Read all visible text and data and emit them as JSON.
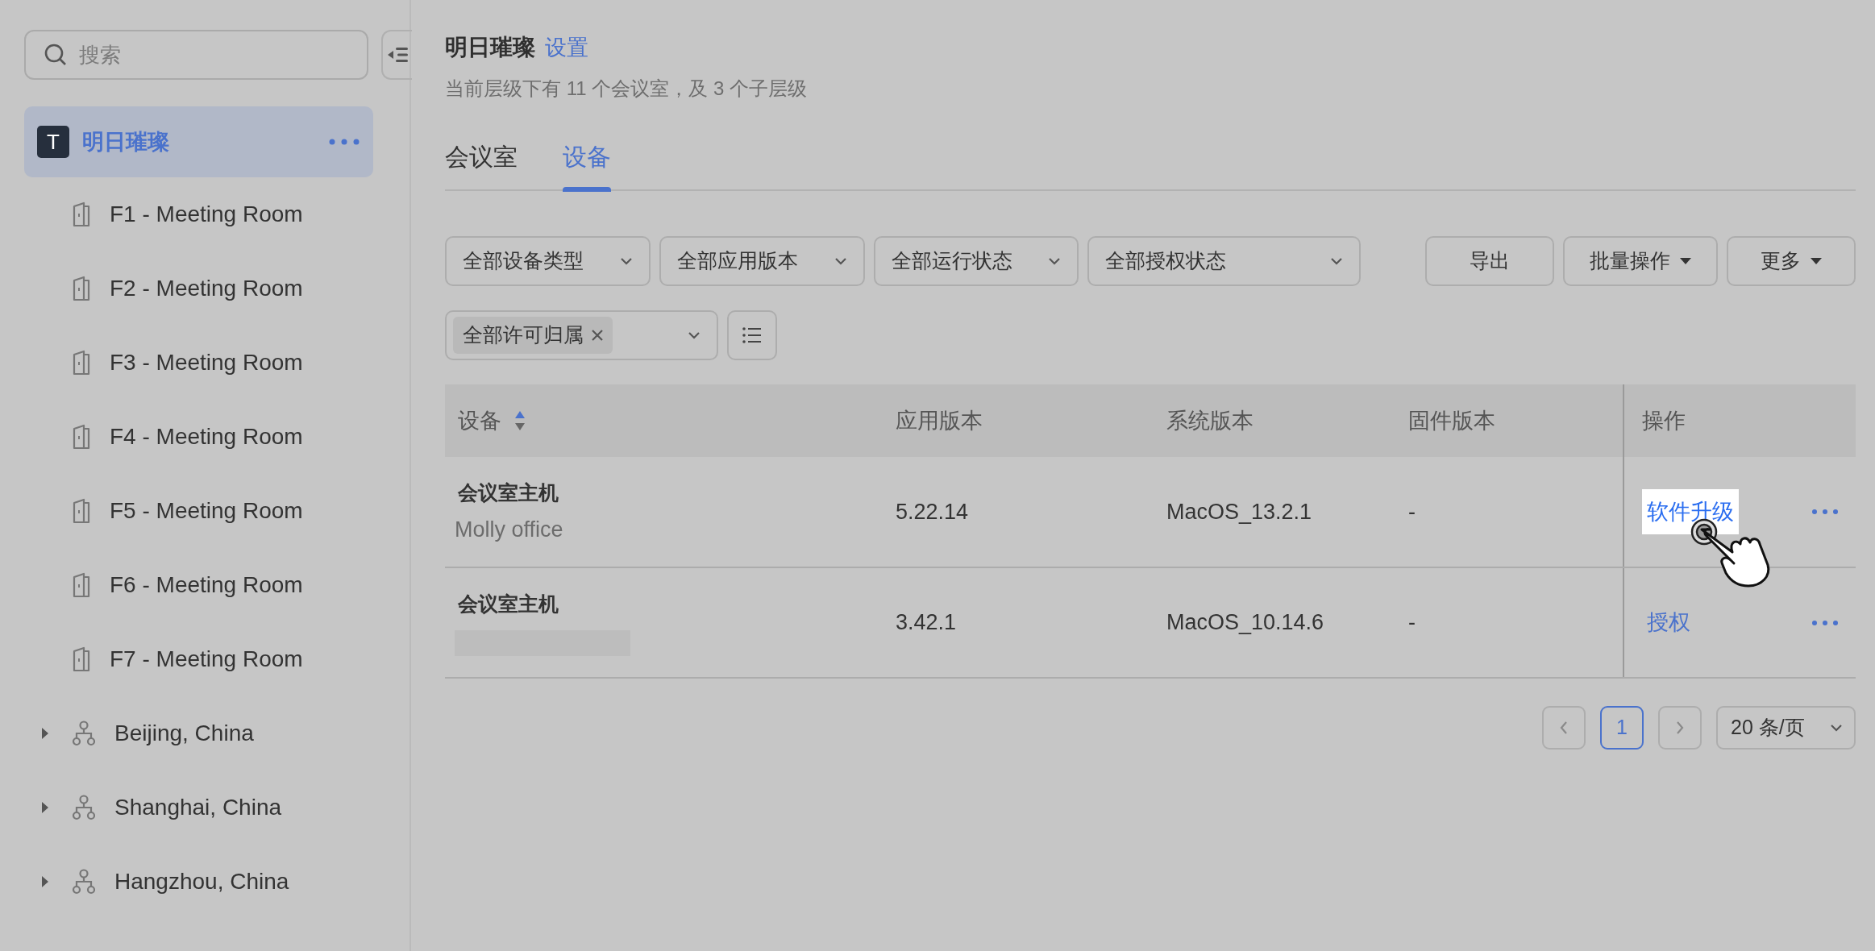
{
  "sidebar": {
    "search": {
      "placeholder": "搜索"
    },
    "tree": [
      {
        "label": "明日璀璨",
        "avatar": "T",
        "kind": "org",
        "selected": true,
        "children": [
          {
            "label": "F1 - Meeting Room",
            "kind": "room",
            "selected": false
          },
          {
            "label": "F2 - Meeting Room",
            "kind": "room",
            "selected": false
          },
          {
            "label": "F3 - Meeting Room",
            "kind": "room",
            "selected": false
          },
          {
            "label": "F4 - Meeting Room",
            "kind": "room",
            "selected": false
          },
          {
            "label": "F5 - Meeting Room",
            "kind": "room",
            "selected": false
          },
          {
            "label": "F6 - Meeting Room",
            "kind": "room",
            "selected": false
          },
          {
            "label": "F7 - Meeting Room",
            "kind": "room",
            "selected": false
          },
          {
            "label": "Beijing, China",
            "kind": "group",
            "selected": false,
            "expanded": false
          },
          {
            "label": "Shanghai, China",
            "kind": "group",
            "selected": false,
            "expanded": false
          },
          {
            "label": "Hangzhou, China",
            "kind": "group",
            "selected": false,
            "expanded": false
          }
        ]
      }
    ]
  },
  "header": {
    "title": "明日璀璨",
    "settings_link": "设置",
    "subtitle": "当前层级下有 11 个会议室，及 3 个子层级"
  },
  "tabs": [
    {
      "label": "会议室",
      "selected": false
    },
    {
      "label": "设备",
      "selected": true
    }
  ],
  "filters": [
    {
      "label": "全部设备类型"
    },
    {
      "label": "全部应用版本"
    },
    {
      "label": "全部运行状态"
    },
    {
      "label": "全部授权状态"
    }
  ],
  "actions": [
    {
      "label": "导出",
      "kind": "button"
    },
    {
      "label": "批量操作",
      "kind": "dropdown"
    },
    {
      "label": "更多",
      "kind": "dropdown"
    }
  ],
  "license_filter": {
    "tag": "全部许可归属"
  },
  "table": {
    "columns": [
      {
        "label": "设备",
        "sortable": true
      },
      {
        "label": "应用版本",
        "sortable": false
      },
      {
        "label": "系统版本",
        "sortable": false
      },
      {
        "label": "固件版本",
        "sortable": false
      },
      {
        "label": "操作",
        "sortable": false
      }
    ],
    "rows": [
      {
        "device": "会议室主机",
        "note": "Molly office",
        "redacted": false,
        "app_version": "5.22.14",
        "system_version": "MacOS_13.2.1",
        "firmware_version": "-",
        "action": "软件升级",
        "highlighted": true
      },
      {
        "device": "会议室主机",
        "redacted": true,
        "app_version": "3.42.1",
        "system_version": "MacOS_10.14.6",
        "firmware_version": "-",
        "action": "授权",
        "highlighted": false
      }
    ]
  },
  "pagination": {
    "pages": [
      {
        "label": "1",
        "selected": true
      }
    ],
    "page_size": "20 条/页"
  }
}
